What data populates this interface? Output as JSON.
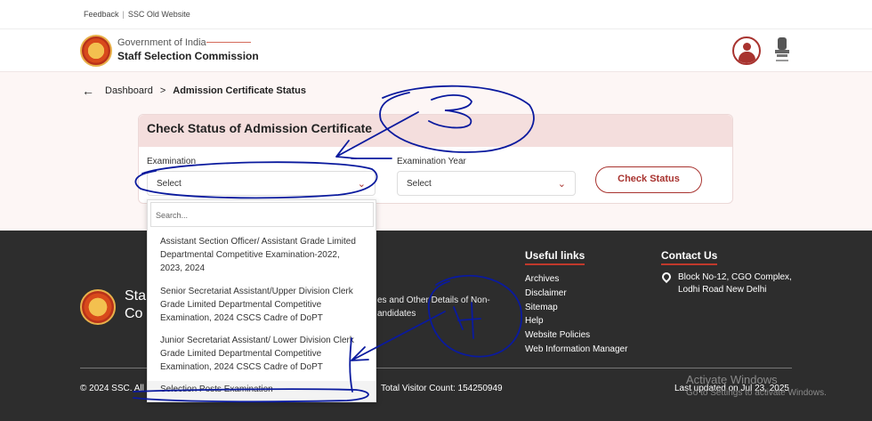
{
  "topbar": {
    "feedback": "Feedback",
    "separator": "|",
    "old_site": "SSC Old Website"
  },
  "header": {
    "gov": "Government of India",
    "org": "Staff Selection Commission"
  },
  "breadcrumb": {
    "back": "←",
    "home": "Dashboard",
    "sep": ">",
    "current": "Admission Certificate Status"
  },
  "card": {
    "title": "Check Status of Admission Certificate",
    "exam_label": "Examination",
    "exam_value": "Select",
    "year_label": "Examination Year",
    "year_value": "Select",
    "button": "Check Status"
  },
  "dropdown": {
    "placeholder": "Search...",
    "options": [
      "Assistant Section Officer/ Assistant Grade Limited Departmental Competitive Examination-2022, 2023, 2024",
      "Senior Secretariat Assistant/Upper Division Clerk Grade Limited Departmental Competitive Examination, 2024 CSCS Cadre of DoPT",
      "Junior Secretariat Assistant/ Lower Division Clerk Grade Limited Departmental Competitive Examination, 2024 CSCS Cadre of DoPT",
      "Selection Posts Examination"
    ]
  },
  "footer": {
    "brand1": "Sta",
    "brand2": "Co",
    "mid1": "es and Other Details of Non-",
    "mid2": "andidates",
    "useful_title": "Useful links",
    "useful_links": [
      "Archives",
      "Disclaimer",
      "Sitemap",
      "Help",
      "Website Policies",
      "Web Information Manager"
    ],
    "contact_title": "Contact Us",
    "address1": "Block No-12, CGO Complex,",
    "address2": "Lodhi Road New Delhi",
    "copyright": "© 2024 SSC. All",
    "visitors": "Total Visitor Count: 154250949",
    "updated": "Last updated on Jul 23, 2025"
  },
  "watermark": {
    "line1": "Activate Windows",
    "line2": "Go to Settings to activate Windows."
  },
  "colors": {
    "accent": "#a8332f",
    "footer_bg": "#2d2d2d",
    "hero_bg": "#fdf6f5",
    "annotation": "#0a1a9e"
  }
}
